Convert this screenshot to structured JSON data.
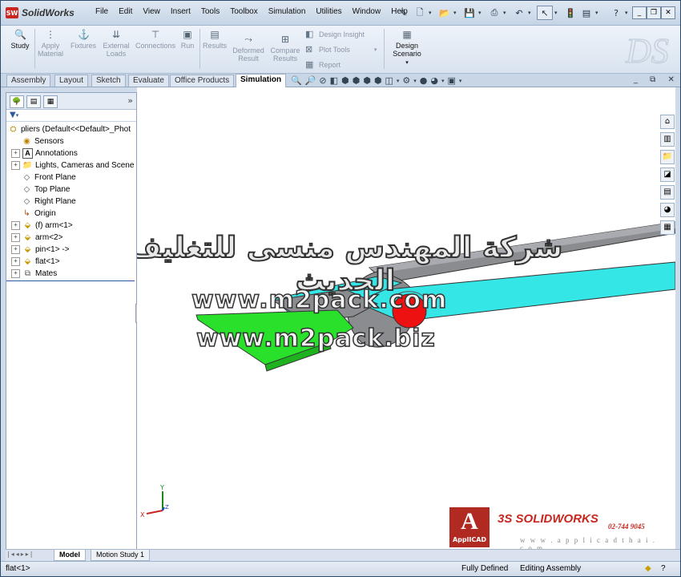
{
  "app": {
    "name": "SolidWorks",
    "logo_badge": "SW"
  },
  "menu": [
    "File",
    "Edit",
    "View",
    "Insert",
    "Tools",
    "Toolbox",
    "Simulation",
    "Utilities",
    "Window",
    "Help"
  ],
  "ribbon": {
    "study": "Study",
    "apply_material": [
      "Apply",
      "Material"
    ],
    "fixtures": "Fixtures",
    "external_loads": [
      "External",
      "Loads"
    ],
    "connections": "Connections",
    "run": "Run",
    "results": "Results",
    "deformed_result": [
      "Deformed",
      "Result"
    ],
    "compare_results": [
      "Compare",
      "Results"
    ],
    "design_insight": "Design Insight",
    "plot_tools": "Plot Tools",
    "report": "Report",
    "design_scenario": [
      "Design",
      "Scenario"
    ]
  },
  "tabs": [
    "Assembly",
    "Layout",
    "Sketch",
    "Evaluate",
    "Office Products",
    "Simulation"
  ],
  "active_tab": "Simulation",
  "feature_tree": {
    "root": "pliers  (Default<<Default>_Phot",
    "items": [
      {
        "label": "Sensors",
        "icon": "sensor-icon",
        "expandable": false
      },
      {
        "label": "Annotations",
        "icon": "annotation-icon",
        "expandable": true
      },
      {
        "label": "Lights, Cameras and Scene",
        "icon": "lights-icon",
        "expandable": true
      },
      {
        "label": "Front Plane",
        "icon": "plane-icon",
        "expandable": false
      },
      {
        "label": "Top Plane",
        "icon": "plane-icon",
        "expandable": false
      },
      {
        "label": "Right Plane",
        "icon": "plane-icon",
        "expandable": false
      },
      {
        "label": "Origin",
        "icon": "origin-icon",
        "expandable": false
      },
      {
        "label": "(f) arm<1>",
        "icon": "part-icon",
        "expandable": true
      },
      {
        "label": "arm<2>",
        "icon": "part-icon",
        "expandable": true
      },
      {
        "label": "pin<1> ->",
        "icon": "part-icon",
        "expandable": true
      },
      {
        "label": "flat<1>",
        "icon": "part-icon",
        "expandable": true
      },
      {
        "label": "Mates",
        "icon": "mates-icon",
        "expandable": true
      }
    ]
  },
  "bottom_tabs": [
    "Model",
    "Motion Study 1"
  ],
  "active_bottom_tab": "Model",
  "status": {
    "selection": "flat<1>",
    "state": "Fully Defined",
    "mode": "Editing Assembly"
  },
  "watermark": {
    "arabic": "شركة المهندس منسى للتغليف الحديث",
    "url1": "www.m2pack.com",
    "url2": "www.m2pack.biz"
  },
  "branding": {
    "badge_letter": "A",
    "badge_text": "ApplICAD",
    "product": "SOLIDWORKS",
    "ds": "3S",
    "phone": "02-744 9045",
    "website": "w w w . a p p l i c a d t h a i . c o m"
  },
  "triad": {
    "x": "X",
    "y": "Y",
    "z": "Z"
  },
  "colors": {
    "accent": "#c8261e",
    "part_gray": "#8a8c90",
    "part_cyan": "#35e6e6",
    "part_green": "#29e02b",
    "pin_red": "#ee1111",
    "tree_highlight": "#2a5aa0"
  }
}
